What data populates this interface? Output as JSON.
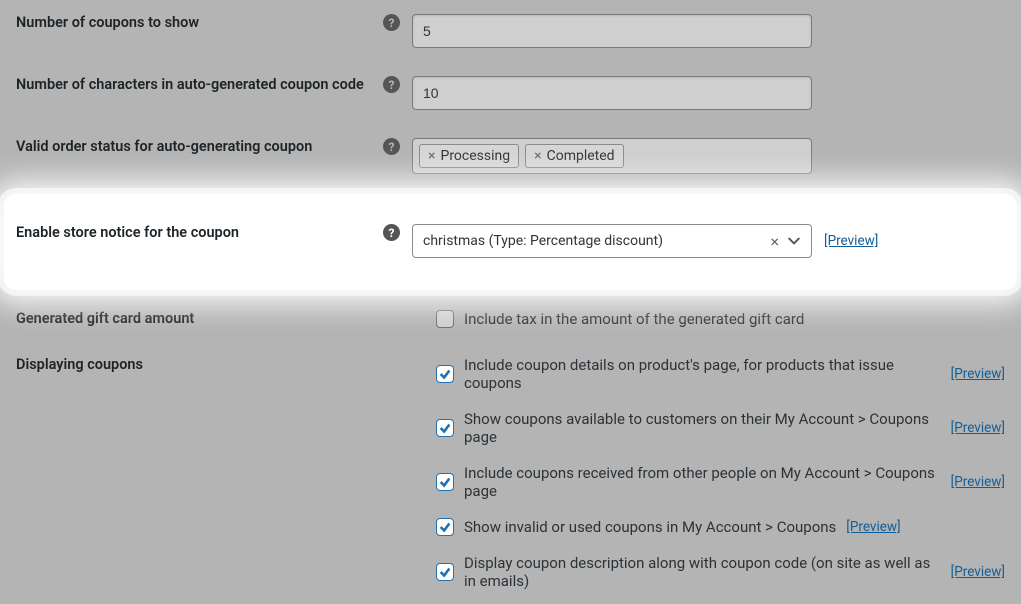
{
  "fields": {
    "numCoupons": {
      "label": "Number of coupons to show",
      "value": "5"
    },
    "numChars": {
      "label": "Number of characters in auto-generated coupon code",
      "value": "10"
    },
    "validStatus": {
      "label": "Valid order status for auto-generating coupon",
      "tags": [
        "Processing",
        "Completed"
      ]
    },
    "storeNotice": {
      "label": "Enable store notice for the coupon",
      "selected": "christmas (Type: Percentage discount)",
      "previewLink": "[Preview]"
    },
    "giftCard": {
      "label": "Generated gift card amount",
      "checkbox": {
        "checked": false,
        "text": "Include tax in the amount of the generated gift card"
      }
    },
    "displaying": {
      "label": "Displaying coupons",
      "items": [
        {
          "checked": true,
          "text": "Include coupon details on product's page, for products that issue coupons",
          "preview": "[Preview]"
        },
        {
          "checked": true,
          "text": "Show coupons available to customers on their My Account > Coupons page",
          "preview": "[Preview]"
        },
        {
          "checked": true,
          "text": "Include coupons received from other people on My Account > Coupons page",
          "preview": "[Preview]"
        },
        {
          "checked": true,
          "text": "Show invalid or used coupons in My Account > Coupons",
          "preview": "[Preview]"
        },
        {
          "checked": true,
          "text": "Display coupon description along with coupon code (on site as well as in emails)",
          "preview": "[Preview]"
        }
      ]
    }
  },
  "icons": {
    "help": "?",
    "remove": "×",
    "clear": "×"
  }
}
